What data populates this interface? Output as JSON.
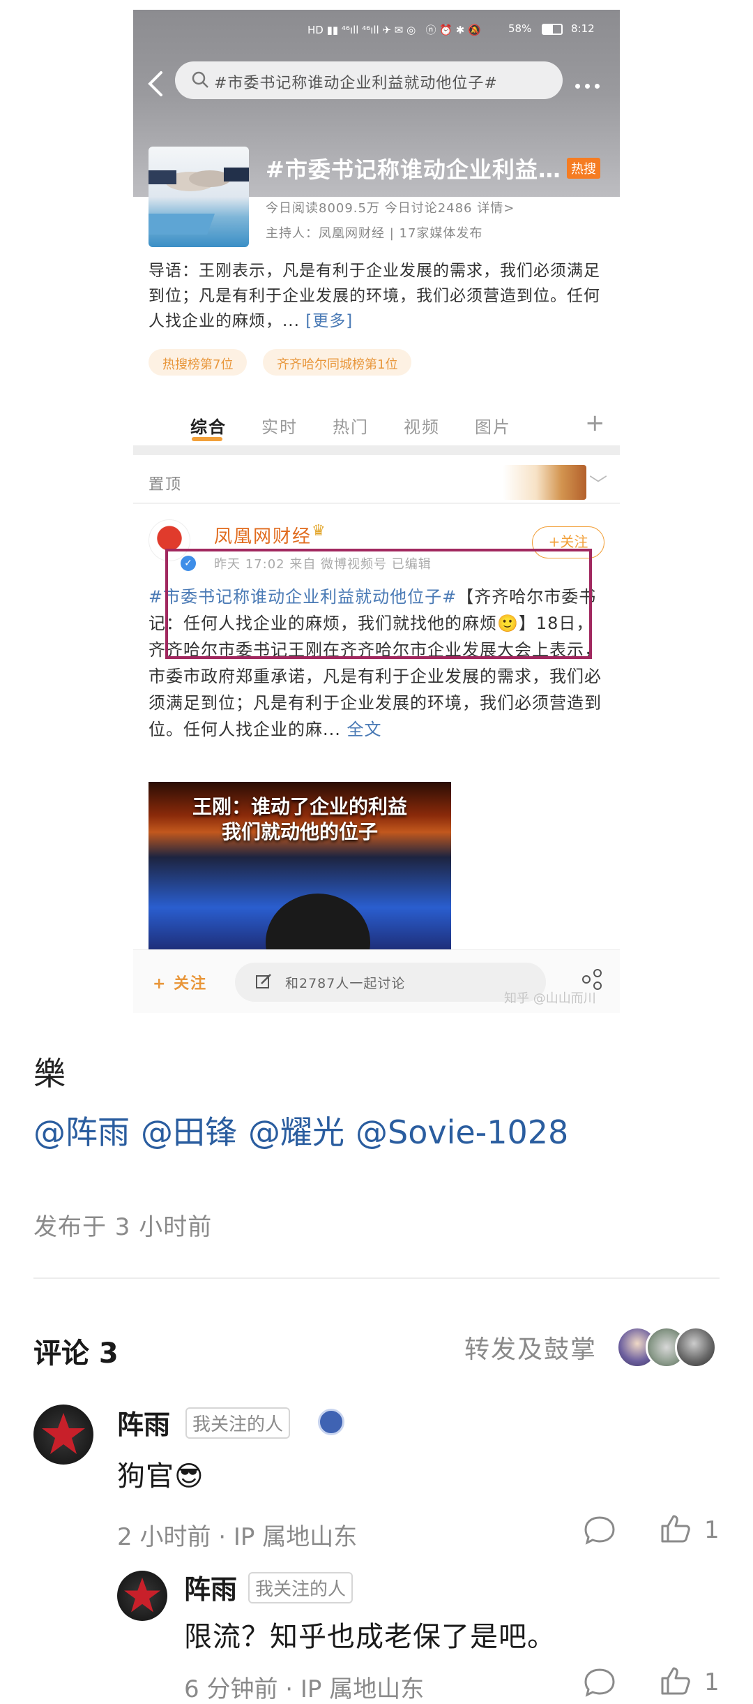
{
  "status_bar": {
    "battery": "58%",
    "time": "8:12"
  },
  "search": {
    "query": "#市委书记称谁动企业利益就动他位子#"
  },
  "topic": {
    "title": "#市委书记称谁动企业利益…",
    "hot_badge": "热搜",
    "stats": "今日阅读8009.5万  今日讨论2486  详情>",
    "host": "主持人：凤凰网财经 | 17家媒体发布",
    "intro": "导语：王刚表示，凡是有利于企业发展的需求，我们必须满足到位；凡是有利于企业发展的环境，我们必须营造到位。任何人找企业的麻烦，...",
    "intro_more": "[更多]",
    "rank_tags": [
      "热搜榜第7位",
      "齐齐哈尔同城榜第1位"
    ]
  },
  "tabs": [
    "综合",
    "实时",
    "热门",
    "视频",
    "图片"
  ],
  "pinned_label": "置顶",
  "post": {
    "author": "凤凰网财经",
    "follow": "+关注",
    "meta": "昨天 17:02  来自 微博视频号  已编辑",
    "hashtag": "#市委书记称谁动企业利益就动他位子#",
    "body": "【齐齐哈尔市委书记：任何人找企业的麻烦，我们就找他的麻烦🙂】18日，齐齐哈尔市委书记王刚在齐齐哈尔市企业发展大会上表示，市委市政府郑重承诺，凡是有利于企业发展的需求，我们必须满足到位；凡是有利于企业发展的环境，我们必须营造到位。任何人找企业的麻...",
    "full_text": "全文",
    "video_caption_line1": "王刚：谁动了企业的利益",
    "video_caption_line2": "我们就动他的位子"
  },
  "bottom_bar": {
    "follow": "+ 关注",
    "discuss": "和2787人一起讨论",
    "watermark": "知乎 @山山而川"
  },
  "answer": {
    "text": "樂",
    "mentions": [
      "@阵雨",
      "@田锋",
      "@耀光",
      "@Sovie-1028"
    ],
    "published": "发布于 3 小时前"
  },
  "comments_header": {
    "title": "评论 3",
    "reposts": "转发及鼓掌"
  },
  "comments": [
    {
      "name": "阵雨",
      "tag": "我关注的人",
      "text": "狗官😎",
      "meta": "2 小时前 · IP 属地山东",
      "likes": "1"
    },
    {
      "name": "阵雨",
      "tag": "我关注的人",
      "text": "限流？知乎也成老保了是吧。",
      "meta": "6 分钟前 · IP 属地山东",
      "likes": "1"
    }
  ],
  "colors": {
    "accent_orange": "#f2a03a",
    "link_blue": "#2a5d9f",
    "highlight_box": "#a1285f"
  }
}
